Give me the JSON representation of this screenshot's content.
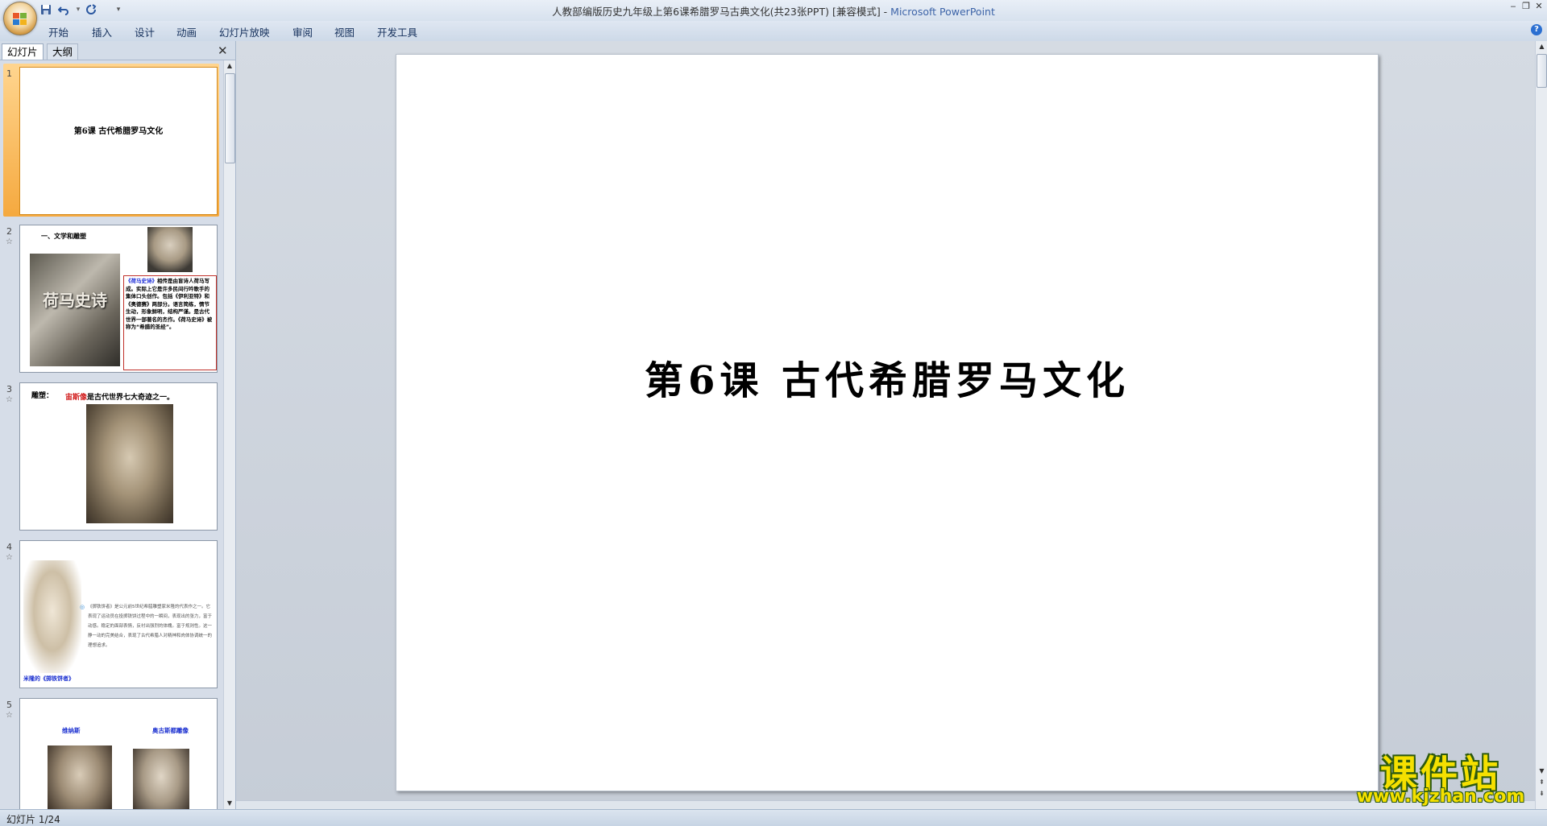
{
  "window": {
    "title": "人教部编版历史九年级上第6课希腊罗马古典文化(共23张PPT) [兼容模式]",
    "separator": " - ",
    "app_name": "Microsoft PowerPoint",
    "buttons": [
      "‒",
      "❐",
      "✕"
    ]
  },
  "quick_access": {
    "save_icon": "save-icon",
    "undo_icon": "undo-icon",
    "redo_icon": "redo-icon",
    "customize_icon": "customize-qat-icon"
  },
  "ribbon": {
    "tabs": [
      "开始",
      "插入",
      "设计",
      "动画",
      "幻灯片放映",
      "审阅",
      "视图",
      "开发工具"
    ],
    "help_label": "?"
  },
  "left_pane": {
    "tabs": [
      "幻灯片",
      "大纲"
    ],
    "close_label": "✕"
  },
  "thumbnails": [
    {
      "number": "1",
      "title": "第6课 古代希腊罗马文化"
    },
    {
      "number": "2",
      "heading": "一、文学和雕塑",
      "image_caption": "荷马史诗",
      "text_highlight": "《荷马史诗》",
      "text": "相传是由盲诗人荷马写成。实际上它是许多民间行吟歌手的集体口头创作。包括《伊利亚特》和《奥德赛》两部分。语言简练，情节生动，形象鲜明，结构严谨。是古代世界一部著名的杰作。《荷马史诗》被称为“希腊的圣经”。"
    },
    {
      "number": "3",
      "label": "雕塑：",
      "title_red": "宙斯像",
      "title_rest": "是古代世界七大奇迹之一。"
    },
    {
      "number": "4",
      "caption": "米隆的《掷铁饼者》",
      "text": "《掷铁饼者》是公元前5世纪希腊雕塑家米隆的代表作之一。它表现了运动员在投掷铁饼过程中的一瞬间，表现出的张力，富于动感。稳定的面部表情，反衬出强烈的体魄。富于规则性。这一静一动的完美结合，表现了古代希腊人对精神和肉体协调统一的理想追求。"
    },
    {
      "number": "5",
      "left_label": "维纳斯",
      "right_label": "奥古斯都雕像"
    }
  ],
  "slide": {
    "title": "第6课 古代希腊罗马文化"
  },
  "status_bar": {
    "slide_counter": "幻灯片 1/24"
  },
  "watermark": {
    "name": "课件站",
    "url": "www.kjzhan.com"
  }
}
